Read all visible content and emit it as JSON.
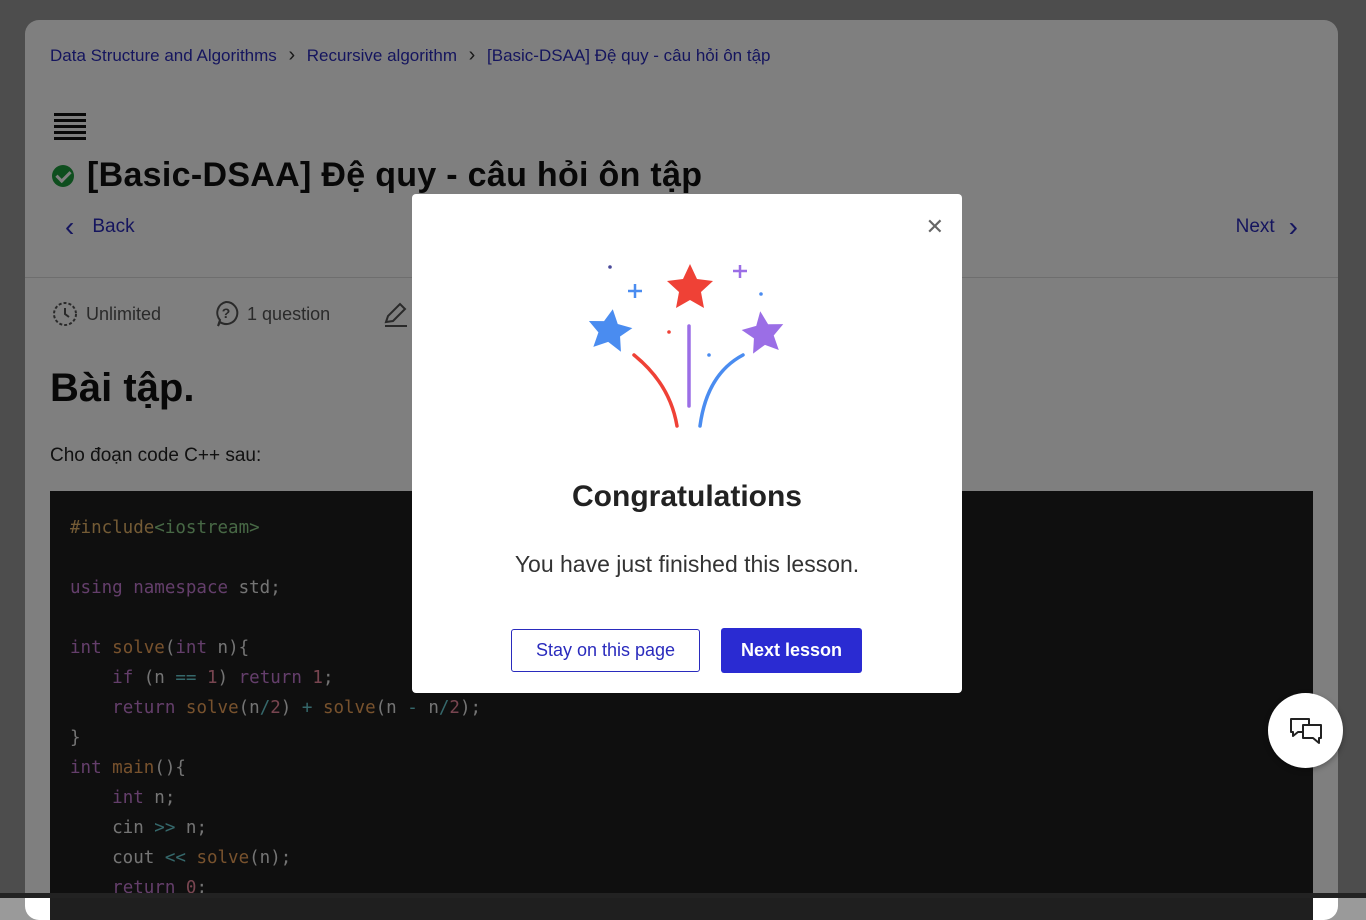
{
  "breadcrumb": [
    {
      "label": "Data Structure and Algorithms"
    },
    {
      "label": "Recursive algorithm"
    },
    {
      "label": "[Basic-DSAA] Đệ quy - câu hỏi ôn tập"
    }
  ],
  "lesson": {
    "title": "[Basic-DSAA] Đệ quy - câu hỏi ôn tập",
    "completed": true
  },
  "nav": {
    "back_label": "Back",
    "next_label": "Next"
  },
  "meta": {
    "time_label": "Unlimited",
    "questions_label": "1 question"
  },
  "content": {
    "section_title": "Bài tập.",
    "intro": "Cho đoạn code C++ sau:",
    "code_lines": [
      "#include<iostream>",
      "",
      "using namespace std;",
      "",
      "int solve(int n){",
      "    if (n == 1) return 1;",
      "    return solve(n/2) + solve(n - n/2);",
      "}",
      "int main(){",
      "    int n;",
      "    cin >> n;",
      "    cout << solve(n);",
      "    return 0;"
    ]
  },
  "modal": {
    "title": "Congratulations",
    "message": "You have just finished this lesson.",
    "stay_label": "Stay on this page",
    "next_label": "Next lesson",
    "close_icon": "close-icon",
    "illustration": "fireworks-stars"
  },
  "colors": {
    "accent": "#2a2bd2",
    "success": "#1c9c3c",
    "code_bg": "#1f1f1f",
    "star_red": "#ef4136",
    "star_blue": "#4a8cf0",
    "star_purple": "#9b6ee6"
  },
  "chat": {
    "icon": "chat-icon"
  }
}
